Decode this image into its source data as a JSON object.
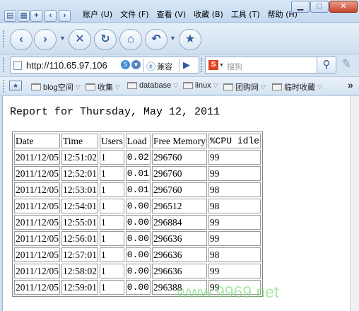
{
  "menu": [
    "账户 (U)",
    "文件 (F)",
    "查看 (V)",
    "收藏 (B)",
    "工具 (T)",
    "帮助 (H)"
  ],
  "window_buttons": {
    "minimize": "▁",
    "maximize": "□",
    "close": "✕"
  },
  "nav_icons": [
    "back-icon",
    "forward-icon",
    "stop-icon",
    "refresh-icon",
    "home-icon",
    "undo-icon",
    "favorite-star-icon"
  ],
  "address": {
    "url": "http://110.65.97.106",
    "compat_label": "兼容",
    "search_placeholder": "搜狗"
  },
  "bookmarks": [
    "blog空间",
    "收集",
    "database",
    "linux",
    "团购网",
    "临时收藏"
  ],
  "report": {
    "title": "Report for Thursday, May 12, 2011",
    "columns": [
      "Date",
      "Time",
      "Users",
      "Load",
      "Free Memory",
      "%CPU idle"
    ],
    "rows": [
      [
        "2011/12/05",
        "12:51:02",
        "1",
        "0.02",
        "296760",
        "99"
      ],
      [
        "2011/12/05",
        "12:52:01",
        "1",
        "0.01",
        "296760",
        "99"
      ],
      [
        "2011/12/05",
        "12:53:01",
        "1",
        "0.01",
        "296760",
        "98"
      ],
      [
        "2011/12/05",
        "12:54:01",
        "1",
        "0.00",
        "296512",
        "98"
      ],
      [
        "2011/12/05",
        "12:55:01",
        "1",
        "0.00",
        "296884",
        "99"
      ],
      [
        "2011/12/05",
        "12:56:01",
        "1",
        "0.00",
        "296636",
        "99"
      ],
      [
        "2011/12/05",
        "12:57:01",
        "1",
        "0.00",
        "296636",
        "98"
      ],
      [
        "2011/12/05",
        "12:58:02",
        "1",
        "0.00",
        "296636",
        "99"
      ],
      [
        "2011/12/05",
        "12:59:01",
        "1",
        "0.00",
        "296388",
        "99"
      ]
    ]
  },
  "watermark": "www.9969.net"
}
